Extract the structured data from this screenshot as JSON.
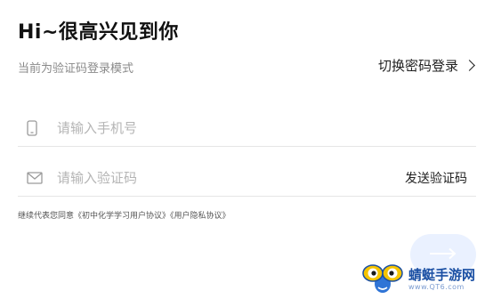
{
  "header": {
    "title": "Hi~很高兴见到你"
  },
  "login_mode": {
    "hint": "当前为验证码登录模式",
    "switch_label": "切换密码登录"
  },
  "phone_field": {
    "placeholder": "请输入手机号",
    "icon": "phone-icon"
  },
  "code_field": {
    "placeholder": "请输入验证码",
    "icon": "mail-icon",
    "send_label": "发送验证码"
  },
  "agreement": {
    "prefix": "继续代表您同意",
    "user_protocol": "《初中化学学习用户协议》",
    "privacy_protocol": "《用户隐私协议》"
  },
  "submit": {
    "icon": "arrow-right-icon"
  },
  "watermark": {
    "name": "蜻蜓手游网",
    "url": "www.QT6.com"
  },
  "colors": {
    "accent_light": "#eaf1ff",
    "placeholder": "#b5b5b5",
    "divider": "#e6e6e6"
  }
}
